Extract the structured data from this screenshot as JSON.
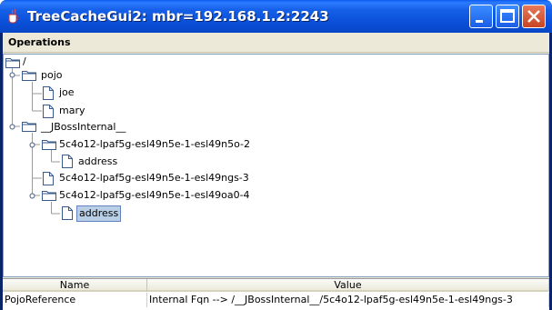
{
  "window": {
    "title": "TreeCacheGui2: mbr=192.168.1.2:2243",
    "icon": "java-cup-icon",
    "controls": [
      "minimize",
      "maximize",
      "close"
    ]
  },
  "menubar": {
    "items": [
      {
        "label": "Operations"
      }
    ]
  },
  "tree": {
    "nodes": [
      {
        "label": "/",
        "type": "folder",
        "depth": 0,
        "expanded": true
      },
      {
        "label": "pojo",
        "type": "folder",
        "depth": 1,
        "expanded": true
      },
      {
        "label": "joe",
        "type": "file",
        "depth": 2
      },
      {
        "label": "mary",
        "type": "file",
        "depth": 2
      },
      {
        "label": "__JBossInternal__",
        "type": "folder",
        "depth": 1,
        "expanded": true
      },
      {
        "label": "5c4o12-lpaf5g-esl49n5e-1-esl49n5o-2",
        "type": "folder",
        "depth": 2,
        "expanded": true
      },
      {
        "label": "address",
        "type": "file",
        "depth": 3
      },
      {
        "label": "5c4o12-lpaf5g-esl49n5e-1-esl49ngs-3",
        "type": "file",
        "depth": 2
      },
      {
        "label": "5c4o12-lpaf5g-esl49n5e-1-esl49oa0-4",
        "type": "folder",
        "depth": 2,
        "expanded": true
      },
      {
        "label": "address",
        "type": "file",
        "depth": 3,
        "selected": true
      }
    ]
  },
  "table": {
    "headers": {
      "name": "Name",
      "value": "Value"
    },
    "rows": [
      {
        "name": "PojoReference",
        "value": "Internal Fqn --> /__JBossInternal__/5c4o12-lpaf5g-esl49n5e-1-esl49ngs-3"
      }
    ]
  },
  "colors": {
    "titlebar": "#0a4fd8",
    "selection": "#b8cfe5",
    "chrome": "#ece9d8"
  }
}
